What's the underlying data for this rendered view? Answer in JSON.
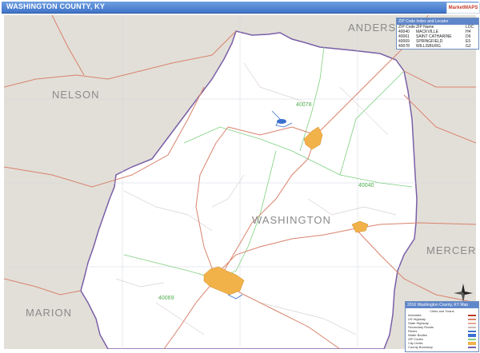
{
  "title": "WASHINGTON COUNTY, KY",
  "logo_text": "MarketMAPS",
  "county_label": "WASHINGTON",
  "neighbor_labels": {
    "nelson": "NELSON",
    "anderson": "ANDERSON",
    "mercer": "MERCER",
    "marion": "MARION"
  },
  "zip_labels": {
    "z40078": "40078",
    "z40040": "40040",
    "z40069": "40069"
  },
  "zip_table": {
    "header": "ZIP Code Index and Locator",
    "columns": [
      "ZIP Code",
      "ZIP Name",
      "LOC"
    ],
    "rows": [
      [
        "40040",
        "MACKVILLE",
        "H4"
      ],
      [
        "40061",
        "SAINT CATHARINE",
        "D6"
      ],
      [
        "40069",
        "SPRINGFIELD",
        "E5"
      ],
      [
        "40078",
        "WILLISBURG",
        "G2"
      ]
    ]
  },
  "legend": {
    "header": "2016 Washington County, KY Map",
    "subtitle": "Cities and Towns",
    "items": [
      "Interstate",
      "US Highway",
      "State Highway",
      "Secondary Roads",
      "Rivers",
      "Water Bodies",
      "ZIP Codes",
      "City Limits",
      "County Boundary"
    ]
  },
  "colors": {
    "county_fill": "#ffffff",
    "outside_fill": "#e2dfd8",
    "county_border": "#7a5fa8",
    "zip_border": "#7ed07e",
    "major_road": "#d9826c",
    "minor_road": "#c9b8b8",
    "city_fill": "#f2b24a",
    "water": "#3a6fd0",
    "title_bar": "#4a7fd4"
  }
}
